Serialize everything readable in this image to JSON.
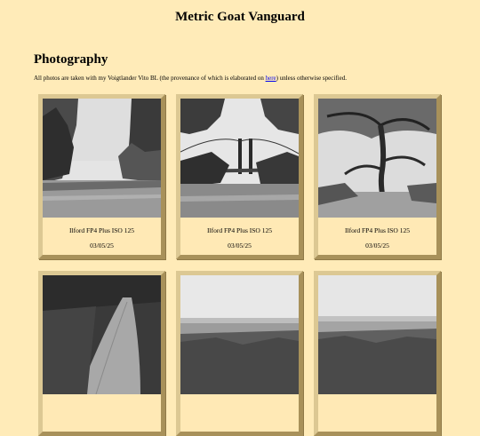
{
  "site": {
    "title": "Metric Goat Vanguard"
  },
  "section": {
    "heading": "Photography",
    "intro_before": "All photos are taken with my Voigtlander Vito BL (the provenance of which is elaborated on ",
    "intro_link": "here",
    "intro_after": ") unless otherwise specified."
  },
  "photos": [
    {
      "film": "Ilford FP4 Plus ISO 125",
      "date": "03/05/25",
      "subject": "river-with-trees"
    },
    {
      "film": "Ilford FP4 Plus ISO 125",
      "date": "03/05/25",
      "subject": "suspension-bridge"
    },
    {
      "film": "Ilford FP4 Plus ISO 125",
      "date": "03/05/25",
      "subject": "gum-tree"
    },
    {
      "film": "",
      "date": "",
      "subject": "dirt-path-bush"
    },
    {
      "film": "",
      "date": "",
      "subject": "landscape-horizon"
    },
    {
      "film": "",
      "date": "",
      "subject": "landscape-horizon"
    }
  ]
}
